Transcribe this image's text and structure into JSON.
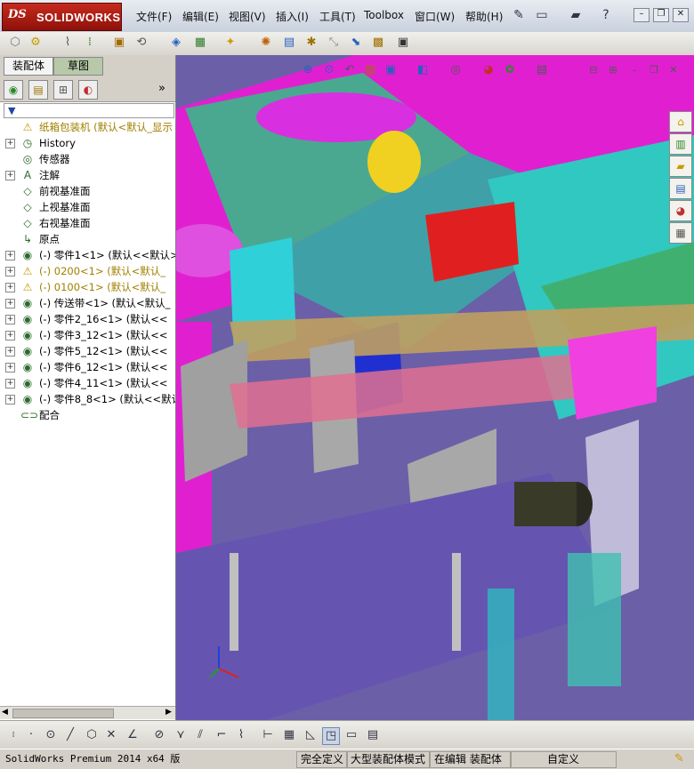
{
  "app": {
    "logo_ds": "DS",
    "logo_name": "SOLIDWORKS",
    "menus": [
      "文件(F)",
      "编辑(E)",
      "视图(V)",
      "插入(I)",
      "工具(T)",
      "Toolbox",
      "窗口(W)",
      "帮助(H)"
    ]
  },
  "panel": {
    "tabs": [
      "装配体",
      "草图"
    ],
    "active_tab": "草图",
    "collapse_glyph": "»"
  },
  "tree": {
    "nodes": [
      {
        "expander": "",
        "icon": "assembly-warning-icon",
        "glyph": "⚠",
        "label": "纸箱包装机  (默认<默认_显示",
        "color": "#a08000"
      },
      {
        "expander": "+",
        "icon": "history-icon",
        "glyph": "◷",
        "label": "History",
        "color": "#000"
      },
      {
        "expander": "",
        "icon": "sensor-icon",
        "glyph": "◎",
        "label": "传感器",
        "color": "#000"
      },
      {
        "expander": "+",
        "icon": "annotation-icon",
        "glyph": "A",
        "label": "注解",
        "color": "#000"
      },
      {
        "expander": "",
        "icon": "plane-icon",
        "glyph": "◇",
        "label": "前视基准面",
        "color": "#000"
      },
      {
        "expander": "",
        "icon": "plane-icon",
        "glyph": "◇",
        "label": "上视基准面",
        "color": "#000"
      },
      {
        "expander": "",
        "icon": "plane-icon",
        "glyph": "◇",
        "label": "右视基准面",
        "color": "#000"
      },
      {
        "expander": "",
        "icon": "origin-icon",
        "glyph": "↳",
        "label": "原点",
        "color": "#000"
      },
      {
        "expander": "+",
        "icon": "part-icon",
        "glyph": "◉",
        "label": "(-) 零件1<1> (默认<<默认>_",
        "color": "#000"
      },
      {
        "expander": "+",
        "icon": "part-warning-icon",
        "glyph": "⚠",
        "label": "(-) 0200<1> (默认<默认_",
        "color": "#a08000"
      },
      {
        "expander": "+",
        "icon": "part-warning-icon",
        "glyph": "⚠",
        "label": "(-) 0100<1> (默认<默认_",
        "color": "#a08000"
      },
      {
        "expander": "+",
        "icon": "part-icon",
        "glyph": "◉",
        "label": "(-) 传送带<1> (默认<默认_",
        "color": "#000"
      },
      {
        "expander": "+",
        "icon": "part-icon",
        "glyph": "◉",
        "label": "(-) 零件2_16<1> (默认<<",
        "color": "#000"
      },
      {
        "expander": "+",
        "icon": "part-icon",
        "glyph": "◉",
        "label": "(-) 零件3_12<1> (默认<<",
        "color": "#000"
      },
      {
        "expander": "+",
        "icon": "part-icon",
        "glyph": "◉",
        "label": "(-) 零件5_12<1> (默认<<",
        "color": "#000"
      },
      {
        "expander": "+",
        "icon": "part-icon",
        "glyph": "◉",
        "label": "(-) 零件6_12<1> (默认<<",
        "color": "#000"
      },
      {
        "expander": "+",
        "icon": "part-icon",
        "glyph": "◉",
        "label": "(-) 零件4_11<1> (默认<<",
        "color": "#000"
      },
      {
        "expander": "+",
        "icon": "part-icon",
        "glyph": "◉",
        "label": "(-) 零件8_8<1> (默认<<默认",
        "color": "#000"
      },
      {
        "expander": "",
        "icon": "mates-icon",
        "glyph": "⊂⊃",
        "label": "配合",
        "color": "#000"
      }
    ]
  },
  "status": {
    "app_version": "SolidWorks Premium 2014 x64 版",
    "fully_defined": "完全定义",
    "large_assembly": "大型装配体模式",
    "editing": "在编辑 装配体",
    "custom": "自定义"
  },
  "colors": {
    "viewport_bg": "#6b5fa8",
    "accent_red": "#c62a1e"
  }
}
